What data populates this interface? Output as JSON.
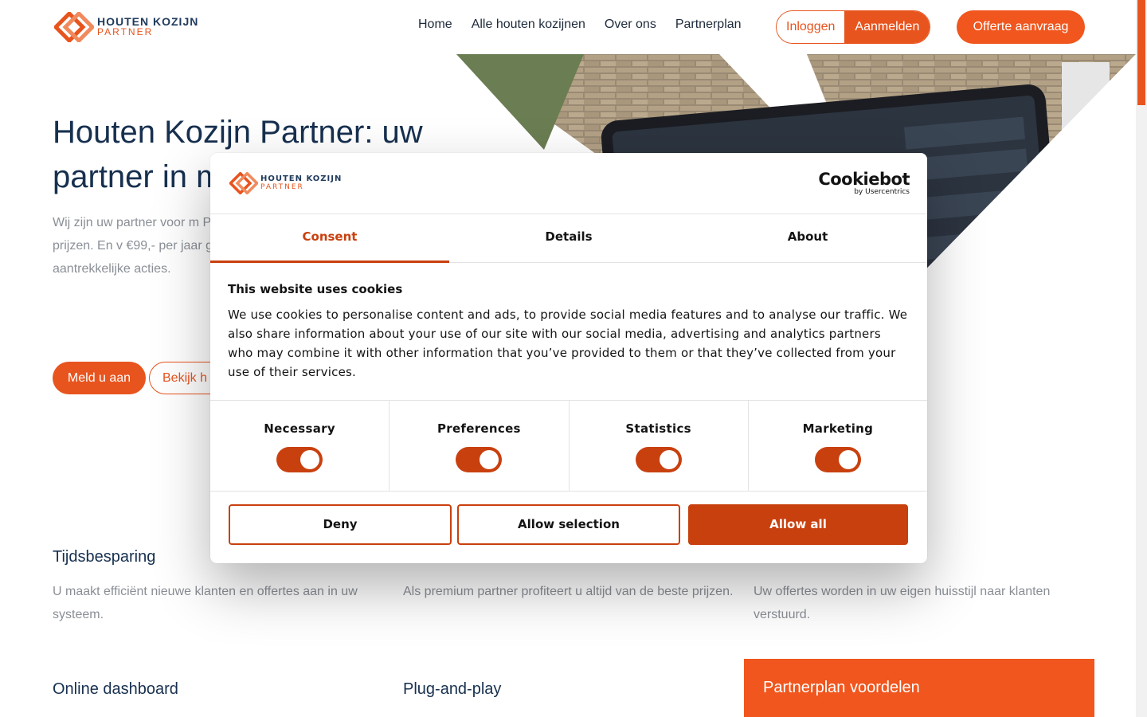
{
  "header": {
    "logo_line1": "HOUTEN KOZIJN",
    "logo_line2": "PARTNER",
    "nav": [
      "Home",
      "Alle houten kozijnen",
      "Over ons",
      "Partnerplan"
    ],
    "login": "Inloggen",
    "signup": "Aanmelden",
    "cta": "Offerte aanvraag"
  },
  "hero": {
    "title": "Houten Kozijn Partner: uw partner in m",
    "text": "Wij zijn uw partner voor m Partner bestelt u al uw hou allerscherpste prijzen. En v €99,- per jaar gebruikmake offertesysteem. U profitee aantrekkelijke acties.",
    "btn_primary": "Meld u aan",
    "btn_secondary": "Bekijk h"
  },
  "features": [
    {
      "title": "Tijdsbesparing",
      "text": "U maakt efficiënt nieuwe klanten en offertes aan in uw systeem."
    },
    {
      "title": "",
      "text": "Als premium partner profiteert u altijd van de beste prijzen."
    },
    {
      "title": "",
      "text": "Uw offertes worden in uw eigen huisstijl naar klanten verstuurd."
    },
    {
      "title": "Online dashboard",
      "text": ""
    },
    {
      "title": "Plug-and-play",
      "text": ""
    }
  ],
  "partner_box": "Partnerplan voordelen",
  "dialog": {
    "logo_line1": "HOUTEN KOZIJN",
    "logo_line2": "PARTNER",
    "brand": "Cookiebot",
    "brand_sub": "by Usercentrics",
    "tabs": [
      "Consent",
      "Details",
      "About"
    ],
    "heading": "This website uses cookies",
    "body": "We use cookies to personalise content and ads, to provide social media features and to analyse our traffic. We also share information about your use of our site with our social media, advertising and analytics partners who may combine it with other information that you’ve provided to them or that they’ve collected from your use of their services.",
    "toggles": [
      {
        "label": "Necessary",
        "on": true
      },
      {
        "label": "Preferences",
        "on": true
      },
      {
        "label": "Statistics",
        "on": true
      },
      {
        "label": "Marketing",
        "on": true
      }
    ],
    "deny": "Deny",
    "allow_selection": "Allow selection",
    "allow_all": "Allow all"
  },
  "colors": {
    "brand_orange": "#e8541e",
    "cookie_accent": "#c9400f",
    "navy": "#17304f"
  }
}
